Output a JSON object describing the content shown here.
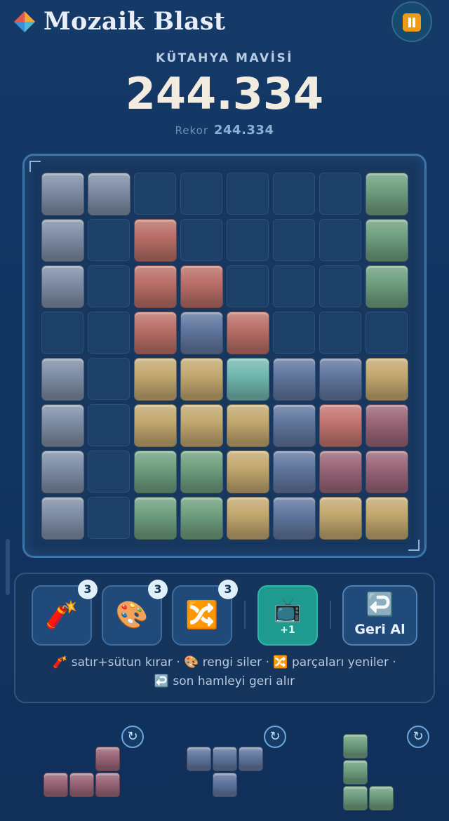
{
  "app": {
    "title": "Mozaik Blast",
    "logo": "diamond-logo-icon",
    "pause_icon": "pause-icon"
  },
  "level": {
    "name": "KÜTAHYA MAVİSİ"
  },
  "score": {
    "value": "244.334",
    "best_label": "Rekor",
    "best_value": "244.334"
  },
  "colors": {
    "slate": "#7f8ea6",
    "blue": "#61779f",
    "red": "#ba6f68",
    "green": "#6f9f80",
    "yellow": "#c3a870",
    "teal": "#72b8b0",
    "rose": "#9a6679",
    "salmon": "#c27570"
  },
  "board": {
    "size": 8,
    "rows": [
      [
        "slate",
        "slate",
        null,
        null,
        null,
        null,
        null,
        "green"
      ],
      [
        "slate",
        null,
        "red",
        null,
        null,
        null,
        null,
        "green"
      ],
      [
        "slate",
        null,
        "red",
        "red",
        null,
        null,
        null,
        "green"
      ],
      [
        null,
        null,
        "red",
        "blue",
        "red",
        null,
        null,
        null
      ],
      [
        "slate",
        null,
        "yellow",
        "yellow",
        "teal",
        "blue",
        "blue",
        "yellow"
      ],
      [
        "slate",
        null,
        "yellow",
        "yellow",
        "yellow",
        "blue",
        "salmon",
        "rose"
      ],
      [
        "slate",
        null,
        "green",
        "green",
        "yellow",
        "blue",
        "rose",
        "rose"
      ],
      [
        "slate",
        null,
        "green",
        "green",
        "yellow",
        "blue",
        "yellow",
        "yellow"
      ]
    ]
  },
  "powerups": [
    {
      "icon": "🧨",
      "name": "dynamite",
      "count": "3"
    },
    {
      "icon": "🎨",
      "name": "palette",
      "count": "3"
    },
    {
      "icon": "🔀",
      "name": "shuffle",
      "count": "3"
    }
  ],
  "bonus": {
    "icon": "📺",
    "label": "+1"
  },
  "undo": {
    "icon": "↩️",
    "label": "Geri Al"
  },
  "help": {
    "line1": "🧨 satır+sütun kırar · 🎨 rengi siler · 🔀 parçaları yeniler ·",
    "line2": "↩️ son hamleyi geri alır"
  },
  "pieces": [
    {
      "color": "rose",
      "cells": [
        [
          0,
          2
        ],
        [
          1,
          0
        ],
        [
          1,
          1
        ],
        [
          1,
          2
        ]
      ]
    },
    {
      "color": "blue",
      "cells": [
        [
          0,
          0
        ],
        [
          0,
          1
        ],
        [
          0,
          2
        ],
        [
          1,
          1
        ]
      ]
    },
    {
      "color": "green",
      "cells": [
        [
          0,
          0
        ],
        [
          1,
          0
        ],
        [
          2,
          0
        ],
        [
          2,
          1
        ]
      ]
    }
  ],
  "rotate_icon": "↻"
}
